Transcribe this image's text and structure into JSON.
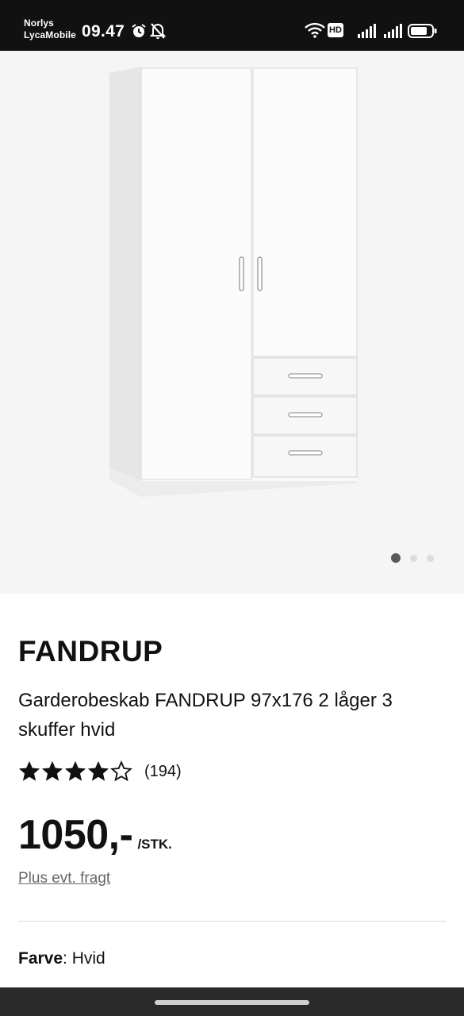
{
  "status_bar": {
    "carrier_line1": "Norlys",
    "carrier_line2": "LycaMobile",
    "time": "09.47",
    "hd_badge": "HD",
    "battery_level": 0.8
  },
  "gallery": {
    "image_icon": "wardrobe-image",
    "page_count": 3,
    "active_page": 1
  },
  "product": {
    "brand": "FANDRUP",
    "description": "Garderobeskab FANDRUP 97x176 2 låger 3 skuffer hvid",
    "rating": 4,
    "rating_max": 5,
    "review_count": "(194)",
    "price": "1050,-",
    "unit": "/STK.",
    "shipping_note": "Plus evt. fragt",
    "color_label": "Farve",
    "color_value": ": Hvid"
  },
  "colors": {
    "statusbar_bg": "#111111",
    "hero_bg": "#f5f5f5",
    "text": "#111111",
    "muted": "#666666"
  }
}
